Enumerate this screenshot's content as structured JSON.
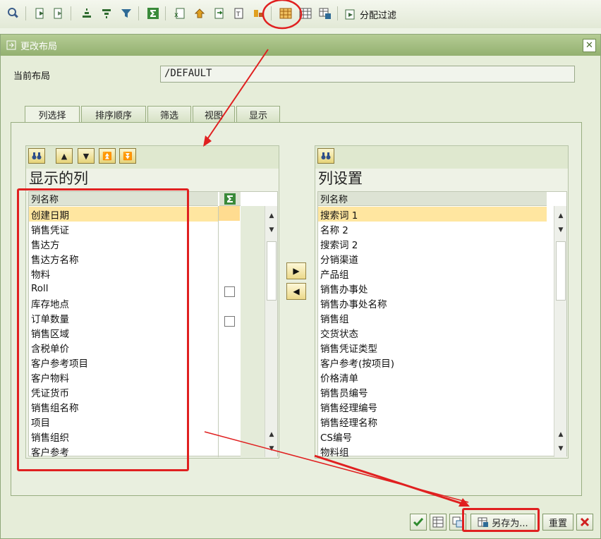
{
  "toolbar": {
    "icons": [
      "inspect-icon",
      "sort-ascending-icon",
      "sort-descending-icon",
      "filter-set-icon",
      "subtotal-icon",
      "funnel-icon",
      "sum-icon",
      "export-excel-icon",
      "print-icon",
      "local-file-icon",
      "word-icon",
      "abc-analysis-icon",
      "change-layout-icon",
      "select-layout-icon",
      "save-layout-icon",
      "graphic-icon"
    ],
    "filter_label": "分配过滤"
  },
  "dialog": {
    "title": "更改布局",
    "layout_label": "当前布局",
    "layout_value": "/DEFAULT",
    "tabs": [
      "列选择",
      "排序顺序",
      "筛选",
      "视图",
      "显示"
    ],
    "active_tab": "列选择"
  },
  "left_pane": {
    "title": "显示的列",
    "col_header": "列名称",
    "sum_header": "Σ",
    "rows": [
      "创建日期",
      "销售凭证",
      "售达方",
      "售达方名称",
      "物料",
      "Roll",
      "库存地点",
      "订单数量",
      "销售区域",
      "含税单价",
      "客户参考项目",
      "客户物料",
      "凭证货币",
      "销售组名称",
      "项目",
      "销售组织",
      "客户参考"
    ],
    "selected_index": 0
  },
  "right_pane": {
    "title": "列设置",
    "col_header": "列名称",
    "rows": [
      "搜索词 1",
      "名称 2",
      "搜索词 2",
      "分销渠道",
      "产品组",
      "销售办事处",
      "销售办事处名称",
      "销售组",
      "交货状态",
      "销售凭证类型",
      "客户参考(按项目)",
      "价格清单",
      "销售员编号",
      "销售经理编号",
      "销售经理名称",
      "CS编号",
      "物料组"
    ],
    "selected_index": 0
  },
  "footer": {
    "save_as_label": "另存为...",
    "reset_label": "重置"
  },
  "colors": {
    "title_bar": "#a4bf82",
    "selected_row": "#ffe6a0",
    "annotation_red": "#e02020"
  }
}
